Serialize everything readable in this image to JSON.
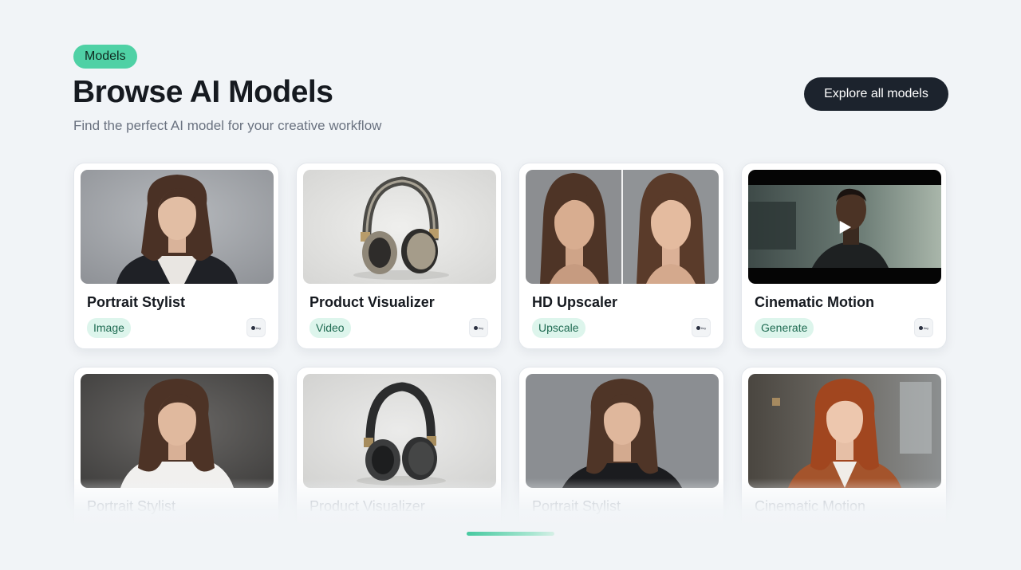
{
  "header": {
    "pill": "Models",
    "title": "Browse AI Models",
    "subtitle": "Find the perfect AI model for your creative workflow",
    "cta": "Explore all models"
  },
  "cards": [
    {
      "title": "Portrait Stylist",
      "tag": "Image",
      "vendor": "tiny",
      "image": "portrait-woman-blazer"
    },
    {
      "title": "Product Visualizer",
      "tag": "Video",
      "vendor": "tiny",
      "image": "headphones-beige"
    },
    {
      "title": "HD Upscaler",
      "tag": "Upscale",
      "vendor": "tiny",
      "image": "portrait-before-after"
    },
    {
      "title": "Cinematic Motion",
      "tag": "Generate",
      "vendor": "tiny",
      "image": "cinematic-video-still"
    },
    {
      "title": "Portrait Stylist",
      "image": "portrait-woman-white-shirt"
    },
    {
      "title": "Product Visualizer",
      "image": "headphones-dark"
    },
    {
      "title": "Portrait Stylist",
      "image": "portrait-woman-black-top"
    },
    {
      "title": "Cinematic Motion",
      "image": "portrait-redhead-office"
    }
  ],
  "colors": {
    "accent": "#4fd1a5",
    "tag_bg": "#ddf5ec",
    "tag_text": "#1f6b52",
    "cta_bg": "#1c232d",
    "page_bg": "#f1f4f7"
  }
}
